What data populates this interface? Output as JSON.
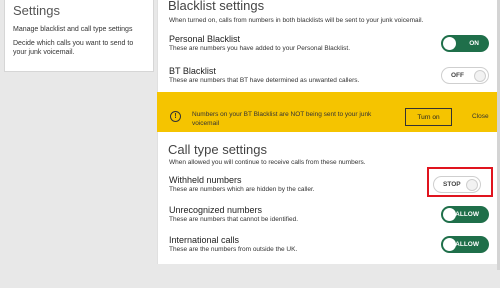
{
  "sidebar": {
    "title": "Settings",
    "line1": "Manage blacklist and call type settings",
    "line2": "Decide which calls you want to send to your junk voicemail."
  },
  "blacklist": {
    "title": "Blacklist settings",
    "subtitle": "When turned on, calls from numbers in both blacklists will be sent to your junk voicemail.",
    "personal": {
      "title": "Personal Blacklist",
      "desc": "These are numbers you have added to your Personal Blacklist.",
      "toggle": "ON"
    },
    "bt": {
      "title": "BT Blacklist",
      "desc": "These are numbers that BT have determined as unwanted callers.",
      "toggle": "OFF"
    }
  },
  "banner": {
    "icon": "!",
    "text": "Numbers on your BT Blacklist are NOT being sent to your junk voicemail",
    "turn_on": "Turn on",
    "close": "Close"
  },
  "calltype": {
    "title": "Call type settings",
    "subtitle": "When allowed you will continue to receive calls from these numbers.",
    "withheld": {
      "title": "Withheld numbers",
      "desc": "These are numbers which are hidden by the caller.",
      "toggle": "STOP"
    },
    "unrecognized": {
      "title": "Unrecognized numbers",
      "desc": "These are numbers that cannot be identified.",
      "toggle": "ALLOW"
    },
    "international": {
      "title": "International calls",
      "desc": "These are the numbers from outside the UK.",
      "toggle": "ALLOW"
    }
  },
  "colors": {
    "toggle_on": "#1f6f4a",
    "banner": "#f5c400",
    "highlight": "#e0141e"
  }
}
